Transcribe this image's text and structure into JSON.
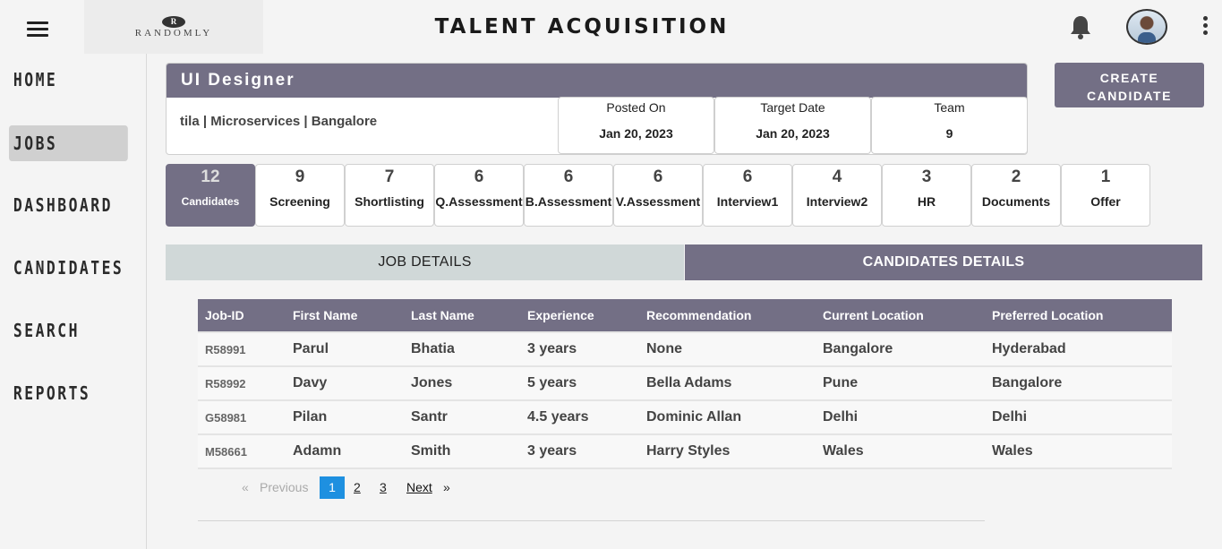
{
  "header": {
    "logo_mark": "R",
    "logo_text": "RANDOMLY",
    "title": "TALENT ACQUISITION"
  },
  "sidebar": {
    "items": [
      {
        "label": "HOME"
      },
      {
        "label": "JOBS",
        "active": true
      },
      {
        "label": "DASHBOARD"
      },
      {
        "label": "CANDIDATES"
      },
      {
        "label": "SEARCH"
      },
      {
        "label": "REPORTS"
      }
    ]
  },
  "job": {
    "title": "UI Designer",
    "meta": "tila | Microservices | Bangalore",
    "stats": [
      {
        "label": "Posted On",
        "value": "Jan 20, 2023"
      },
      {
        "label": "Target Date",
        "value": "Jan 20, 2023"
      },
      {
        "label": "Team",
        "value": "9"
      }
    ]
  },
  "create_button": {
    "line1": "CREATE",
    "line2": "CANDIDATE"
  },
  "stages": [
    {
      "count": "12",
      "name": "Candidates",
      "active": true
    },
    {
      "count": "9",
      "name": "Screening"
    },
    {
      "count": "7",
      "name": "Shortlisting"
    },
    {
      "count": "6",
      "name": "Q.Assessment"
    },
    {
      "count": "6",
      "name": "B.Assessment"
    },
    {
      "count": "6",
      "name": "V.Assessment"
    },
    {
      "count": "6",
      "name": "Interview1"
    },
    {
      "count": "4",
      "name": "Interview2"
    },
    {
      "count": "3",
      "name": "HR"
    },
    {
      "count": "2",
      "name": "Documents"
    },
    {
      "count": "1",
      "name": "Offer"
    }
  ],
  "tabs": {
    "job_details": "JOB DETAILS",
    "candidates_details": "CANDIDATES DETAILS",
    "active": "candidates_details"
  },
  "table": {
    "headers": [
      "Job-ID",
      "First Name",
      "Last Name",
      "Experience",
      "Recommendation",
      "Current Location",
      "Preferred Location"
    ],
    "rows": [
      [
        "R58991",
        "Parul",
        "Bhatia",
        "3 years",
        "None",
        "Bangalore",
        "Hyderabad"
      ],
      [
        "R58992",
        "Davy",
        "Jones",
        "5 years",
        "Bella Adams",
        "Pune",
        "Bangalore"
      ],
      [
        "G58981",
        "Pilan",
        "Santr",
        "4.5 years",
        "Dominic Allan",
        "Delhi",
        "Delhi"
      ],
      [
        "M58661",
        "Adamn",
        "Smith",
        "3 years",
        "Harry Styles",
        "Wales",
        "Wales"
      ]
    ]
  },
  "pagination": {
    "prev_arrow": "«",
    "prev": "Previous",
    "pages": [
      "1",
      "2",
      "3"
    ],
    "current": "1",
    "next": "Next",
    "next_arrow": "»"
  },
  "colors": {
    "accent": "#736f85",
    "page_active": "#1e90e0",
    "tab_inactive": "#d0d8d8"
  }
}
